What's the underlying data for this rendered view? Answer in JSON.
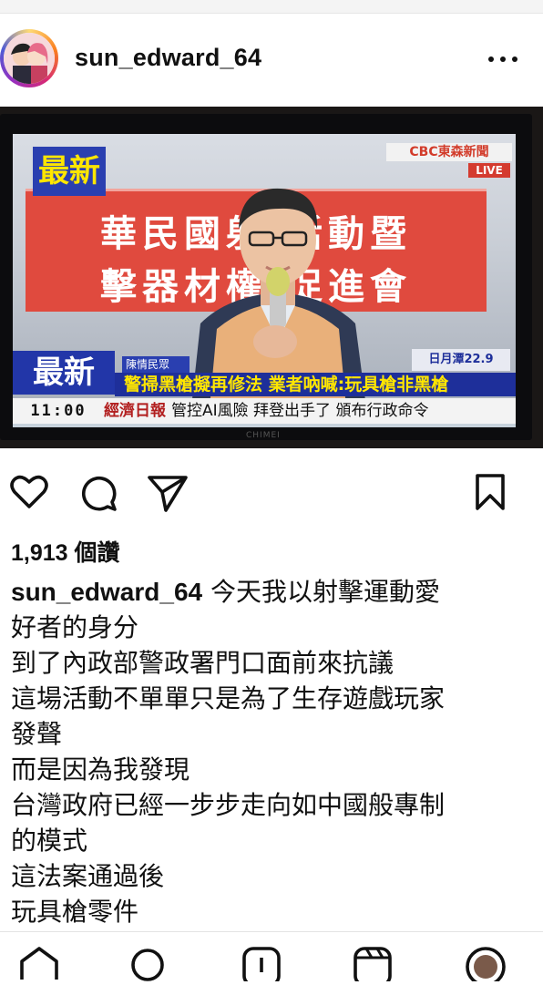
{
  "post": {
    "username": "sun_edward_64",
    "more_label": "More options"
  },
  "media": {
    "tag_latest": "最新",
    "station": "CBC東森新聞",
    "live": "LIVE",
    "banner_line1": "華民國射 活動暨",
    "banner_line2": "擊器材權 促進會",
    "lower_tag": "最新",
    "source_tag": "陳情民眾",
    "headline": "警掃黑槍擬再修法 業者吶喊:玩具槍非黑槍",
    "weather": "日月潭22.9",
    "ticker_time": "11:00",
    "ticker_source": "經濟日報",
    "ticker_text": "管控AI風險 拜登出手了 頒布行政命令",
    "tv_brand": "CHIMEI"
  },
  "likes": "1,913 個讚",
  "caption": {
    "username": "sun_edward_64",
    "lines": [
      "今天我以射擊運動愛",
      "好者的身分",
      "到了內政部警政署門口面前來抗議",
      "這場活動不單單只是為了生存遊戲玩家",
      "發聲",
      "而是因為我發現",
      "台灣政府已經一步步走向如中國般專制",
      "的模式",
      "這法案通過後",
      "玩具槍零件"
    ]
  },
  "icons": {
    "like": "heart-icon",
    "comment": "comment-icon",
    "share": "send-icon",
    "save": "bookmark-icon",
    "home": "home-icon",
    "search": "search-icon",
    "create": "create-icon",
    "reels": "reels-icon",
    "profile": "profile-icon"
  },
  "colors": {
    "banner_red": "#e04a3e",
    "news_blue": "#1e2f9a",
    "headline_yellow": "#ffe600"
  }
}
